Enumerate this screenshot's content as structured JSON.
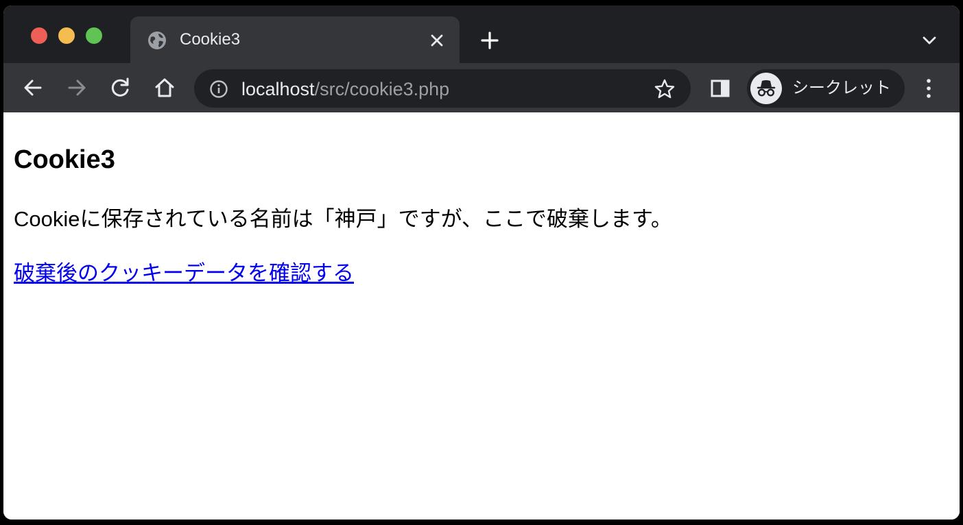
{
  "tab": {
    "title": "Cookie3",
    "favicon": "globe-icon"
  },
  "toolbar": {
    "url_host": "localhost",
    "url_path": "/src/cookie3.php",
    "incognito_label": "シークレット"
  },
  "page": {
    "heading": "Cookie3",
    "message": "Cookieに保存されている名前は「神戸」ですが、ここで破棄します。",
    "link_text": "破棄後のクッキーデータを確認する"
  },
  "colors": {
    "tabbar_bg": "#1f2023",
    "toolbar_bg": "#35363a",
    "omnibox_bg": "#202124",
    "link": "#0000ee"
  }
}
